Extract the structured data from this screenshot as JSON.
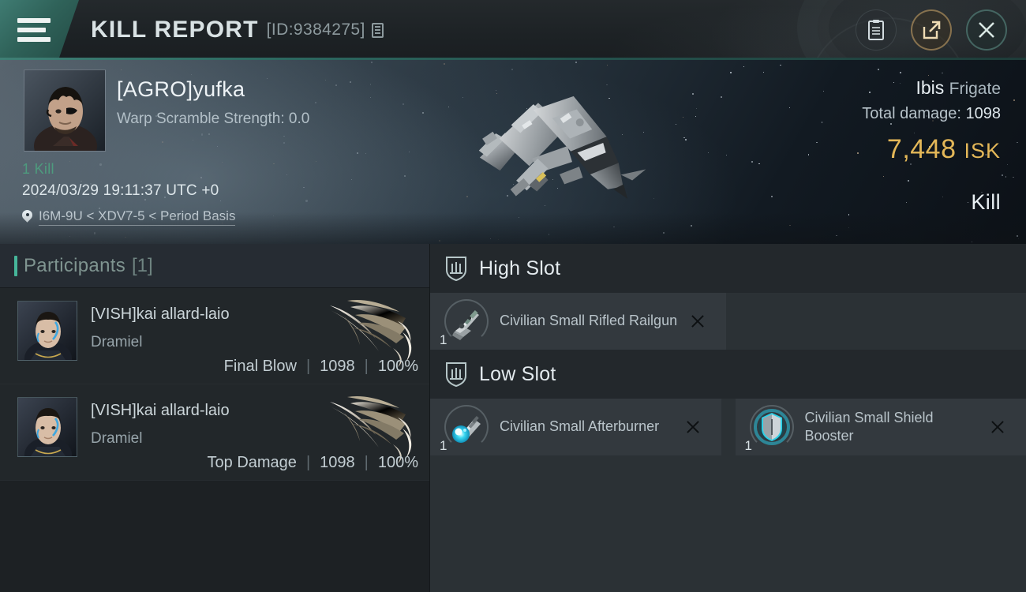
{
  "header": {
    "menu_icon": "hamburger-icon",
    "title": "KILL REPORT",
    "report_id": "[ID:9384275]",
    "copy_icon": "copy-icon",
    "actions": [
      {
        "name": "report-button",
        "icon": "clipboard-icon"
      },
      {
        "name": "share-button",
        "icon": "external-link-icon"
      },
      {
        "name": "close-button",
        "icon": "close-icon"
      }
    ]
  },
  "victim": {
    "avatar_icon": "victim-portrait",
    "name": "[AGRO]yufka",
    "warp_scramble": "Warp Scramble Strength: 0.0",
    "kill_count": "1 Kill",
    "timestamp": "2024/03/29 19:11:37 UTC +0",
    "location_icon": "map-pin-icon",
    "location": "I6M-9U < XDV7-5 < Period Basis",
    "ship_name": "Ibis",
    "ship_class": "Frigate",
    "total_damage_label": "Total damage:",
    "total_damage_value": "1098",
    "isk_value": "7,448",
    "isk_unit": "ISK",
    "result": "Kill"
  },
  "participants": {
    "title": "Participants",
    "count": "[1]",
    "rows": [
      {
        "avatar_icon": "participant-portrait",
        "name": "[VISH]kai allard-laio",
        "ship": "Dramiel",
        "ship_icon": "dramiel-ship-icon",
        "role": "Final Blow",
        "damage": "1098",
        "percent": "100%"
      },
      {
        "avatar_icon": "participant-portrait",
        "name": "[VISH]kai allard-laio",
        "ship": "Dramiel",
        "ship_icon": "dramiel-ship-icon",
        "role": "Top Damage",
        "damage": "1098",
        "percent": "100%"
      }
    ]
  },
  "fitting": {
    "sections": [
      {
        "icon": "high-slot-shield-icon",
        "title": "High Slot",
        "modules": [
          {
            "icon": "railgun-icon",
            "qty": "1",
            "name": "Civilian Small Rifled Railgun",
            "remove_icon": "remove-icon"
          }
        ]
      },
      {
        "icon": "low-slot-shield-icon",
        "title": "Low Slot",
        "modules": [
          {
            "icon": "afterburner-icon",
            "qty": "1",
            "name": "Civilian Small Afterburner",
            "remove_icon": "remove-icon"
          },
          {
            "icon": "shield-booster-icon",
            "qty": "1",
            "name": "Civilian Small Shield Booster",
            "remove_icon": "remove-icon"
          }
        ]
      }
    ]
  },
  "colors": {
    "accent_teal": "#46b69a",
    "isk_gold": "#e3b758",
    "kill_green": "#4e9b7e",
    "left_panel": "#1d2124",
    "right_panel": "#2b3135"
  }
}
